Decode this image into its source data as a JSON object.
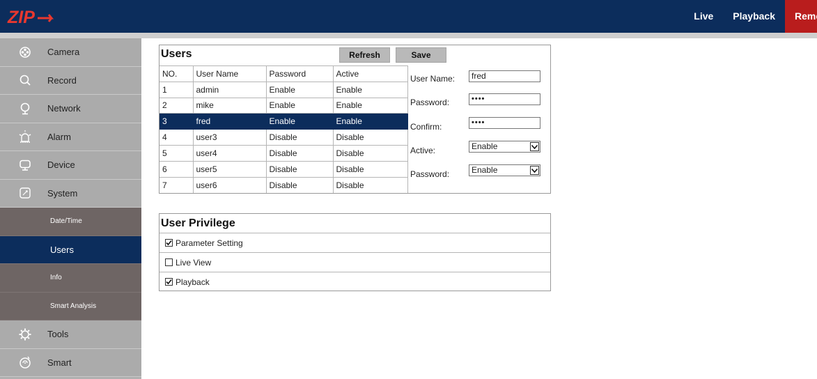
{
  "header": {
    "logo_text": "ZIP",
    "nav": [
      {
        "label": "Live"
      },
      {
        "label": "Playback"
      },
      {
        "label": "Remote"
      }
    ]
  },
  "sidebar": {
    "items": [
      {
        "label": "Camera",
        "icon": "camera-icon"
      },
      {
        "label": "Record",
        "icon": "record-icon"
      },
      {
        "label": "Network",
        "icon": "network-icon"
      },
      {
        "label": "Alarm",
        "icon": "alarm-icon"
      },
      {
        "label": "Device",
        "icon": "device-icon"
      },
      {
        "label": "System",
        "icon": "system-icon"
      }
    ],
    "system_subitems": [
      {
        "label": "Date/Time"
      },
      {
        "label": "Users"
      },
      {
        "label": "Info"
      },
      {
        "label": "Smart Analysis"
      }
    ],
    "items_after": [
      {
        "label": "Tools",
        "icon": "tools-icon"
      },
      {
        "label": "Smart",
        "icon": "smart-icon"
      }
    ],
    "active": "Users"
  },
  "users": {
    "title": "Users",
    "refresh_label": "Refresh",
    "save_label": "Save",
    "columns": [
      "NO.",
      "User Name",
      "Password",
      "Active"
    ],
    "rows": [
      [
        "1",
        "admin",
        "Enable",
        "Enable"
      ],
      [
        "2",
        "mike",
        "Enable",
        "Enable"
      ],
      [
        "3",
        "fred",
        "Enable",
        "Enable"
      ],
      [
        "4",
        "user3",
        "Disable",
        "Disable"
      ],
      [
        "5",
        "user4",
        "Disable",
        "Disable"
      ],
      [
        "6",
        "user5",
        "Disable",
        "Disable"
      ],
      [
        "7",
        "user6",
        "Disable",
        "Disable"
      ]
    ],
    "selected_row": 2,
    "form": {
      "username_label": "User Name:",
      "username_value": "fred",
      "password_label": "Password:",
      "password_value": "••••",
      "confirm_label": "Confirm:",
      "confirm_value": "••••",
      "active_label": "Active:",
      "active_value": "Enable",
      "password_enable_label": "Password:",
      "password_enable_value": "Enable"
    }
  },
  "privilege": {
    "title": "User Privilege",
    "items": [
      {
        "label": "Parameter Setting",
        "checked": true
      },
      {
        "label": "Live View",
        "checked": false
      },
      {
        "label": "Playback",
        "checked": true
      }
    ]
  },
  "colors": {
    "navy": "#0c2d5c",
    "remote_red": "#b91d1d",
    "sidebar_gray": "#ababab",
    "submenu_brown": "#6e6564"
  }
}
